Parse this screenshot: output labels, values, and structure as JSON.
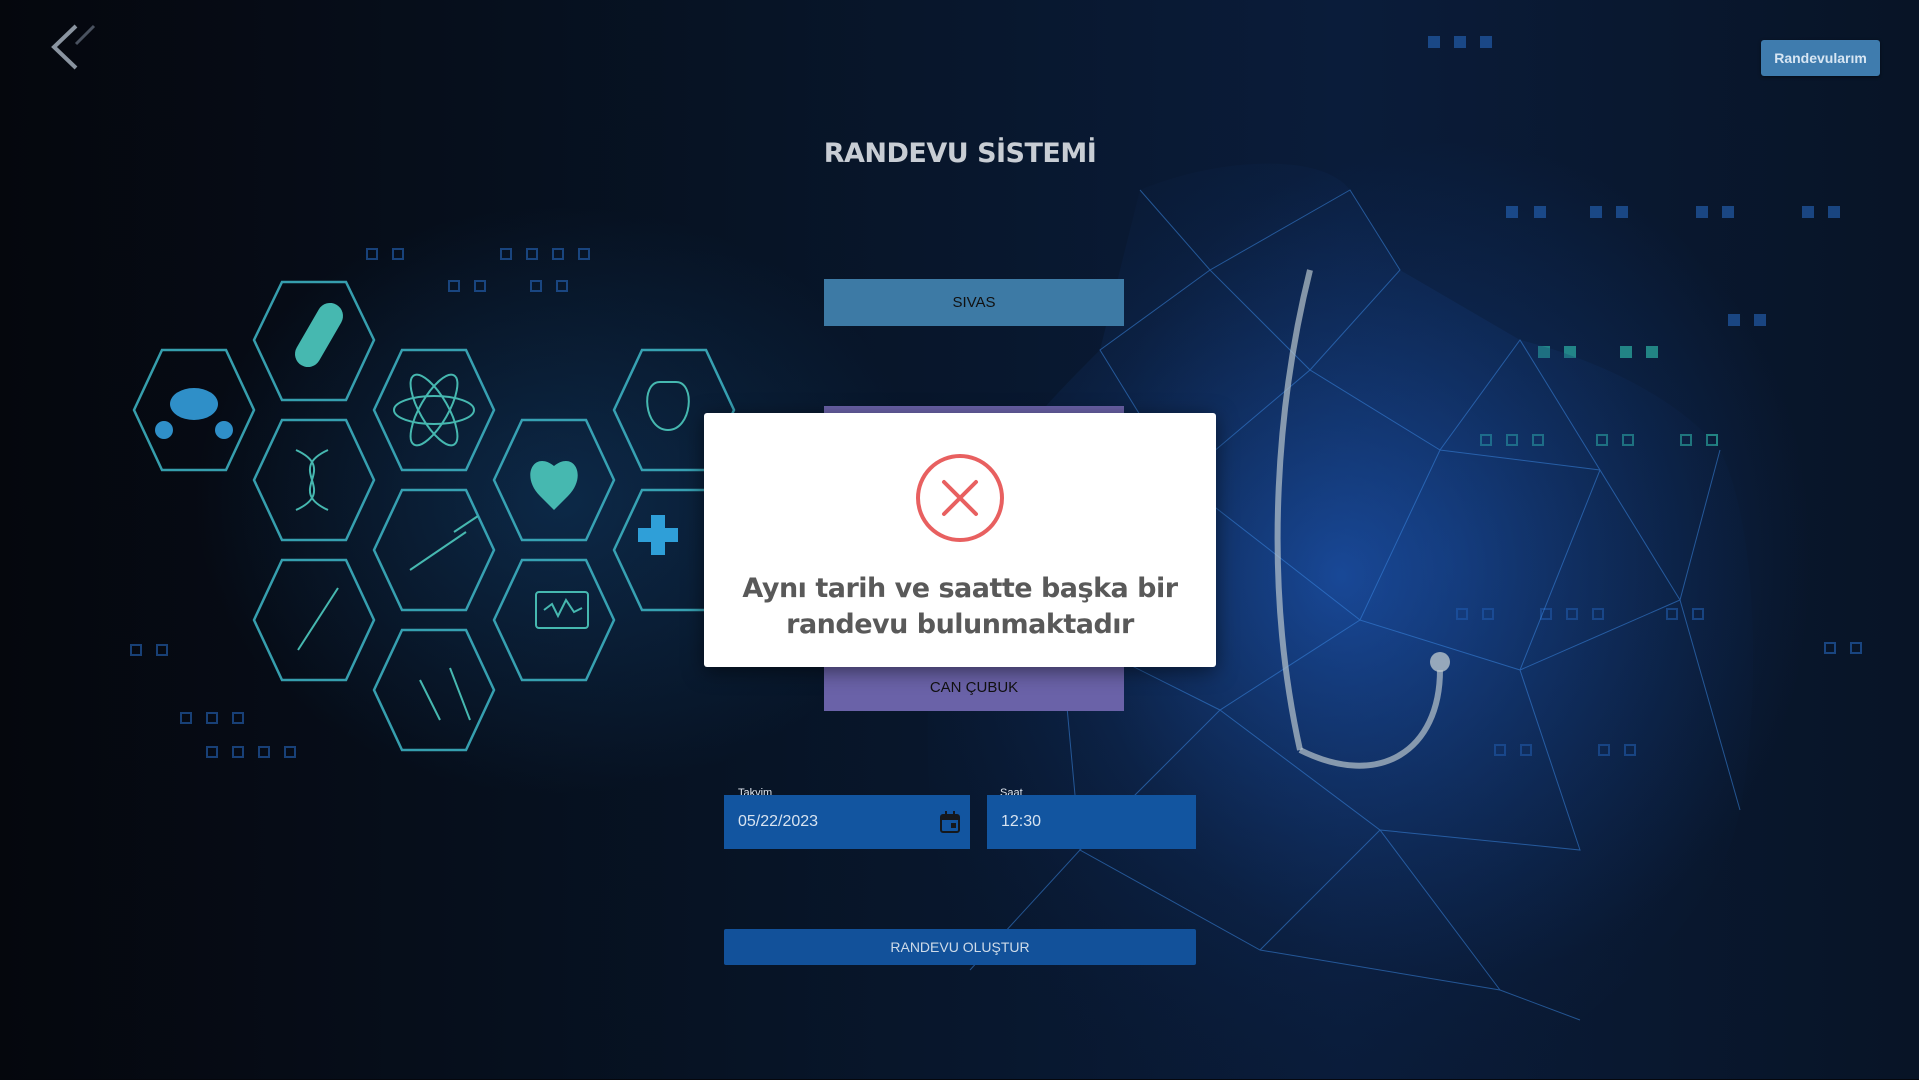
{
  "header": {
    "back_icon": "chevron-left-icon",
    "appointments_button": "Randevularım",
    "page_title": "RANDEVU SİSTEMİ"
  },
  "form": {
    "city_select": "SIVAS",
    "doctor_select": "CAN ÇUBUK",
    "date_label": "Takvim",
    "date_value": "05/22/2023",
    "time_label": "Saat",
    "time_value": "12:30",
    "calendar_icon": "calendar-icon",
    "submit_button": "RANDEVU OLUŞTUR"
  },
  "dialog": {
    "icon": "error-x-icon",
    "message_line1": "Aynı tarih ve saatte başka bir",
    "message_line2": "randevu bulunmaktadır"
  },
  "colors": {
    "accent_blue": "#3f7cae",
    "purple_select": "#6a62a8",
    "field_blue": "#1255a0",
    "error_red": "#e86060"
  }
}
